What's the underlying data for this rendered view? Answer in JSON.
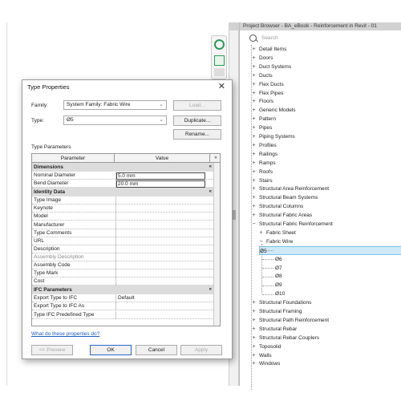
{
  "project_browser": {
    "title": "Project Browser - BA_eBook - Reinforcement in Revit - 01",
    "search_placeholder": "Search",
    "items": [
      {
        "label": "Detail Items",
        "exp": "+"
      },
      {
        "label": "Doors",
        "exp": "+"
      },
      {
        "label": "Duct Systems",
        "exp": "+"
      },
      {
        "label": "Ducts",
        "exp": "+"
      },
      {
        "label": "Flex Ducts",
        "exp": "+"
      },
      {
        "label": "Flex Pipes",
        "exp": "+"
      },
      {
        "label": "Floors",
        "exp": "+"
      },
      {
        "label": "Generic Models",
        "exp": "+"
      },
      {
        "label": "Pattern",
        "exp": "+"
      },
      {
        "label": "Pipes",
        "exp": "+"
      },
      {
        "label": "Piping Systems",
        "exp": "+"
      },
      {
        "label": "Profiles",
        "exp": "+"
      },
      {
        "label": "Railings",
        "exp": "+"
      },
      {
        "label": "Ramps",
        "exp": "+"
      },
      {
        "label": "Roofs",
        "exp": "+"
      },
      {
        "label": "Stairs",
        "exp": "+"
      },
      {
        "label": "Structural Area Reinforcement",
        "exp": "+"
      },
      {
        "label": "Structural Beam Systems",
        "exp": "+"
      },
      {
        "label": "Structural Columns",
        "exp": "+"
      },
      {
        "label": "Structural Fabric Areas",
        "exp": "+"
      },
      {
        "label": "Structural Fabric Reinforcement",
        "exp": "−"
      }
    ],
    "fabric_children": [
      {
        "label": "Fabric Sheet",
        "exp": "+"
      },
      {
        "label": "Fabric Wire",
        "exp": "−"
      }
    ],
    "wires": [
      "Ø5",
      "Ø6",
      "Ø7",
      "Ø8",
      "Ø9",
      "Ø10"
    ],
    "items_after": [
      {
        "label": "Structural Foundations",
        "exp": "+"
      },
      {
        "label": "Structural Framing",
        "exp": "+"
      },
      {
        "label": "Structural Path Reinforcement",
        "exp": "+"
      },
      {
        "label": "Structural Rebar",
        "exp": "+"
      },
      {
        "label": "Structural Rebar Couplers",
        "exp": "+"
      },
      {
        "label": "Toposolid",
        "exp": "+"
      },
      {
        "label": "Walls",
        "exp": "+"
      },
      {
        "label": "Windows",
        "exp": "+"
      }
    ]
  },
  "dialog": {
    "title": "Type Properties",
    "close_glyph": "✕",
    "family_label": "Family:",
    "family_value": "System Family: Fabric Wire",
    "load_label": "Load...",
    "type_label": "Type:",
    "type_value": "Ø5",
    "duplicate_label": "Duplicate...",
    "rename_label": "Rename...",
    "type_parameters_label": "Type Parameters",
    "col_parameter": "Parameter",
    "col_value": "Value",
    "groups": {
      "dimensions": "Dimensions",
      "identity": "Identity Data",
      "ifc": "IFC Parameters"
    },
    "dimension_rows": [
      {
        "name": "Nominal Diameter",
        "value": "5.0 mm"
      },
      {
        "name": "Bend Diameter",
        "value": "20.0 mm"
      }
    ],
    "identity_rows": [
      {
        "name": "Type Image",
        "value": ""
      },
      {
        "name": "Keynote",
        "value": ""
      },
      {
        "name": "Model",
        "value": ""
      },
      {
        "name": "Manufacturer",
        "value": ""
      },
      {
        "name": "Type Comments",
        "value": ""
      },
      {
        "name": "URL",
        "value": ""
      },
      {
        "name": "Description",
        "value": ""
      },
      {
        "name": "Assembly Description",
        "value": "",
        "grey": true
      },
      {
        "name": "Assembly Code",
        "value": ""
      },
      {
        "name": "Type Mark",
        "value": ""
      },
      {
        "name": "Cost",
        "value": ""
      }
    ],
    "ifc_rows": [
      {
        "name": "Export Type to IFC",
        "value": "Default"
      },
      {
        "name": "Export Type to IFC As",
        "value": ""
      },
      {
        "name": "Type IFC Predefined Type",
        "value": ""
      }
    ],
    "help_link": "What do these properties do?",
    "preview_label": "<< Preview",
    "ok_label": "OK",
    "cancel_label": "Cancel",
    "apply_label": "Apply",
    "collapse_glyph": "«"
  }
}
